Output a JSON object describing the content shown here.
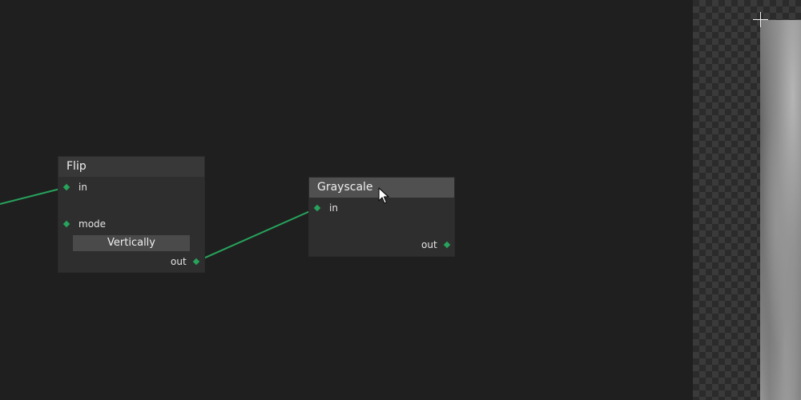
{
  "graph": {
    "nodes": [
      {
        "id": "flip",
        "title": "Flip",
        "inputs": [
          "in",
          "mode"
        ],
        "outputs": [
          "out"
        ],
        "mode_value": "Vertically"
      },
      {
        "id": "grayscale",
        "title": "Grayscale",
        "selected": true,
        "inputs": [
          "in"
        ],
        "outputs": [
          "out"
        ]
      }
    ],
    "wire_color": "#27a35c"
  },
  "preview": {
    "checker_colors": [
      "#2b2b2b",
      "#3a3a3a"
    ]
  },
  "cursor": {
    "icon": "arrow-cursor-icon"
  }
}
